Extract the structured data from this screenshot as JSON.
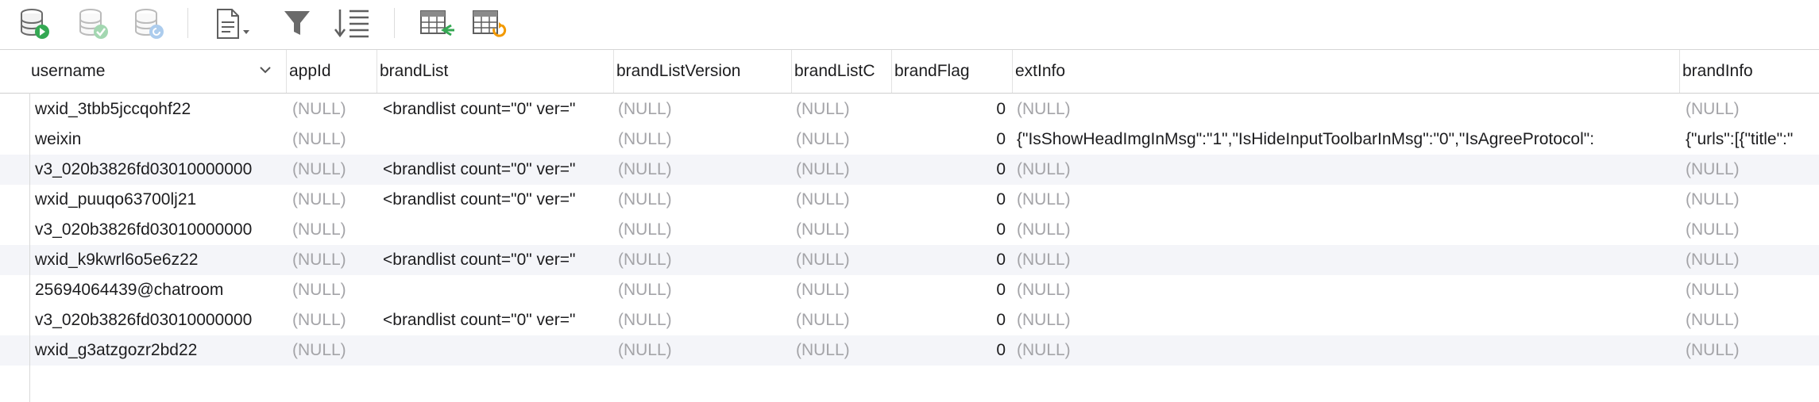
{
  "toolbar": {
    "buttons": [
      {
        "name": "run-query-button",
        "icon": "database-run-icon"
      },
      {
        "name": "commit-button",
        "icon": "database-commit-icon"
      },
      {
        "name": "rollback-button",
        "icon": "database-rollback-icon"
      },
      {
        "name": "export-button",
        "icon": "document-dropdown-icon"
      },
      {
        "name": "filter-button",
        "icon": "filter-icon"
      },
      {
        "name": "sort-button",
        "icon": "sort-lines-icon"
      },
      {
        "name": "import-table-button",
        "icon": "table-import-icon"
      },
      {
        "name": "refresh-table-button",
        "icon": "table-refresh-icon"
      }
    ]
  },
  "table": {
    "columns": [
      "username",
      "appId",
      "brandList",
      "brandListVersion",
      "brandListC",
      "brandFlag",
      "extInfo",
      "brandInfo"
    ],
    "rows": [
      {
        "username": "wxid_3tbb5jccqohf22",
        "appId": "(NULL)",
        "brandList": "<brandlist count=\"0\" ver=\"",
        "brandListVersion": "(NULL)",
        "brandListC": "(NULL)",
        "brandFlag": "0",
        "extInfo": "(NULL)",
        "brandInfo": "(NULL)"
      },
      {
        "username": "weixin",
        "appId": "(NULL)",
        "brandList": "",
        "brandListVersion": "(NULL)",
        "brandListC": "(NULL)",
        "brandFlag": "0",
        "extInfo": "{\"IsShowHeadImgInMsg\":\"1\",\"IsHideInputToolbarInMsg\":\"0\",\"IsAgreeProtocol\":",
        "brandInfo": "{\"urls\":[{\"title\":\""
      },
      {
        "username": "v3_020b3826fd03010000000",
        "appId": "(NULL)",
        "brandList": "<brandlist count=\"0\" ver=\"",
        "brandListVersion": "(NULL)",
        "brandListC": "(NULL)",
        "brandFlag": "0",
        "extInfo": "(NULL)",
        "brandInfo": "(NULL)"
      },
      {
        "username": "wxid_puuqo63700lj21",
        "appId": "(NULL)",
        "brandList": "<brandlist count=\"0\" ver=\"",
        "brandListVersion": "(NULL)",
        "brandListC": "(NULL)",
        "brandFlag": "0",
        "extInfo": "(NULL)",
        "brandInfo": "(NULL)"
      },
      {
        "username": "v3_020b3826fd03010000000",
        "appId": "(NULL)",
        "brandList": "",
        "brandListVersion": "(NULL)",
        "brandListC": "(NULL)",
        "brandFlag": "0",
        "extInfo": "(NULL)",
        "brandInfo": "(NULL)"
      },
      {
        "username": "wxid_k9kwrl6o5e6z22",
        "appId": "(NULL)",
        "brandList": "<brandlist count=\"0\" ver=\"",
        "brandListVersion": "(NULL)",
        "brandListC": "(NULL)",
        "brandFlag": "0",
        "extInfo": "(NULL)",
        "brandInfo": "(NULL)"
      },
      {
        "username": "25694064439@chatroom",
        "appId": "(NULL)",
        "brandList": "",
        "brandListVersion": "(NULL)",
        "brandListC": "(NULL)",
        "brandFlag": "0",
        "extInfo": "(NULL)",
        "brandInfo": "(NULL)"
      },
      {
        "username": "v3_020b3826fd03010000000",
        "appId": "(NULL)",
        "brandList": "<brandlist count=\"0\" ver=\"",
        "brandListVersion": "(NULL)",
        "brandListC": "(NULL)",
        "brandFlag": "0",
        "extInfo": "(NULL)",
        "brandInfo": "(NULL)"
      },
      {
        "username": "wxid_g3atzgozr2bd22",
        "appId": "(NULL)",
        "brandList": "",
        "brandListVersion": "(NULL)",
        "brandListC": "(NULL)",
        "brandFlag": "0",
        "extInfo": "(NULL)",
        "brandInfo": "(NULL)"
      }
    ]
  },
  "colors": {
    "null_text": "#a4a4a8",
    "alt_row": "#f4f5f9",
    "accent_green": "#34a853",
    "accent_orange": "#f29900"
  }
}
